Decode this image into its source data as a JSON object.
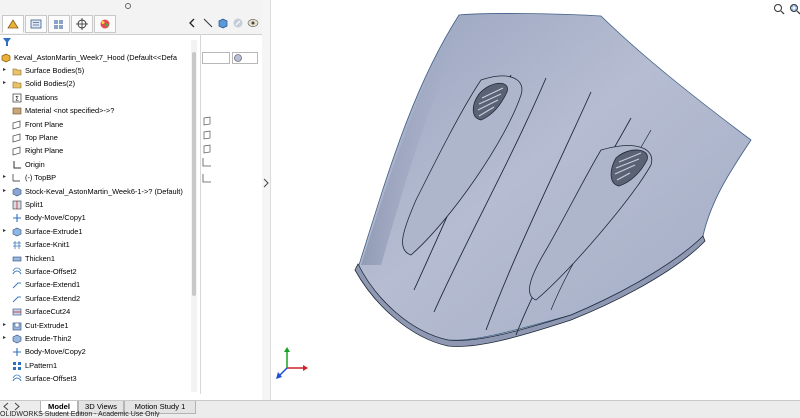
{
  "feature_tree": {
    "root_label": "Keval_AstonMartin_Week7_Hood  (Default<<Defa",
    "items": [
      {
        "label": "Surface Bodies(5)",
        "icon": "folder-icon",
        "expandable": true
      },
      {
        "label": "Solid Bodies(2)",
        "icon": "folder-icon",
        "expandable": true
      },
      {
        "label": "Equations",
        "icon": "equations-icon",
        "expandable": false
      },
      {
        "label": "Material <not specified>->?",
        "icon": "material-icon",
        "expandable": false
      },
      {
        "label": "Front Plane",
        "icon": "plane-icon",
        "expandable": false
      },
      {
        "label": "Top Plane",
        "icon": "plane-icon",
        "expandable": false
      },
      {
        "label": "Right Plane",
        "icon": "plane-icon",
        "expandable": false
      },
      {
        "label": "Origin",
        "icon": "origin-icon",
        "expandable": false
      },
      {
        "label": "(-) TopBP",
        "icon": "sketch-icon",
        "expandable": true
      },
      {
        "label": "Stock-Keval_AstonMartin_Week6-1->? (Default)",
        "icon": "part-icon",
        "expandable": true
      },
      {
        "label": "Split1",
        "icon": "split-icon",
        "expandable": false
      },
      {
        "label": "Body-Move/Copy1",
        "icon": "move-icon",
        "expandable": false
      },
      {
        "label": "Surface-Extrude1",
        "icon": "surface-extrude-icon",
        "expandable": true
      },
      {
        "label": "Surface-Knit1",
        "icon": "knit-icon",
        "expandable": false
      },
      {
        "label": "Thicken1",
        "icon": "thicken-icon",
        "expandable": false
      },
      {
        "label": "Surface-Offset2",
        "icon": "offset-icon",
        "expandable": false
      },
      {
        "label": "Surface-Extend1",
        "icon": "extend-icon",
        "expandable": false
      },
      {
        "label": "Surface-Extend2",
        "icon": "extend-icon",
        "expandable": false
      },
      {
        "label": "SurfaceCut24",
        "icon": "surface-cut-icon",
        "expandable": false
      },
      {
        "label": "Cut-Extrude1",
        "icon": "cut-extrude-icon",
        "expandable": true
      },
      {
        "label": "Extrude-Thin2",
        "icon": "extrude-icon",
        "expandable": true
      },
      {
        "label": "Body-Move/Copy2",
        "icon": "move-icon",
        "expandable": false
      },
      {
        "label": "LPattern1",
        "icon": "pattern-icon",
        "expandable": false
      },
      {
        "label": "Surface-Offset3",
        "icon": "offset-icon",
        "expandable": false
      }
    ]
  },
  "bottom_tabs": [
    "Model",
    "3D Views",
    "Motion Study 1"
  ],
  "active_tab": "Model",
  "status_text": "OLIDWORKS Student Edition - Academic Use Only",
  "colors": {
    "model_fill": "#a9b2ca",
    "model_edge": "#1f2a3a",
    "accent_blue": "#2f6fc1",
    "axis_x": "#d0202a",
    "axis_y": "#1aa025",
    "axis_z": "#1f4fd0"
  }
}
